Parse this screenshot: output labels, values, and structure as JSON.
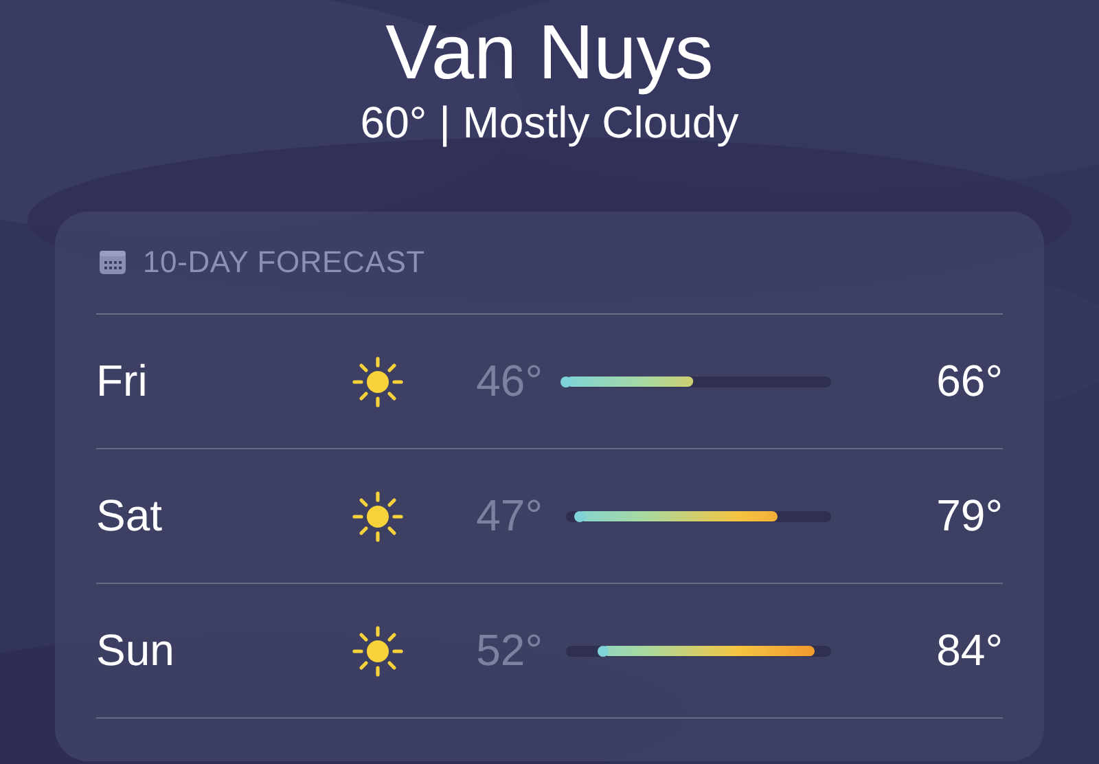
{
  "location": {
    "city": "Van Nuys",
    "summary": "60° | Mostly Cloudy"
  },
  "forecast": {
    "title": "10-DAY FORECAST",
    "days": [
      {
        "day": "Fri",
        "low": "46°",
        "high": "66°",
        "bar": {
          "from": {
            "level": 0
          },
          "to": {
            "level": 0.48
          }
        }
      },
      {
        "day": "Sat",
        "low": "47°",
        "high": "79°",
        "bar": {
          "from": {
            "level": 0.05
          },
          "to": {
            "level": 0.8
          }
        }
      },
      {
        "day": "Sun",
        "low": "52°",
        "high": "84°",
        "bar": {
          "from": {
            "level": 0.14
          },
          "to": {
            "level": 0.94
          }
        }
      }
    ]
  }
}
